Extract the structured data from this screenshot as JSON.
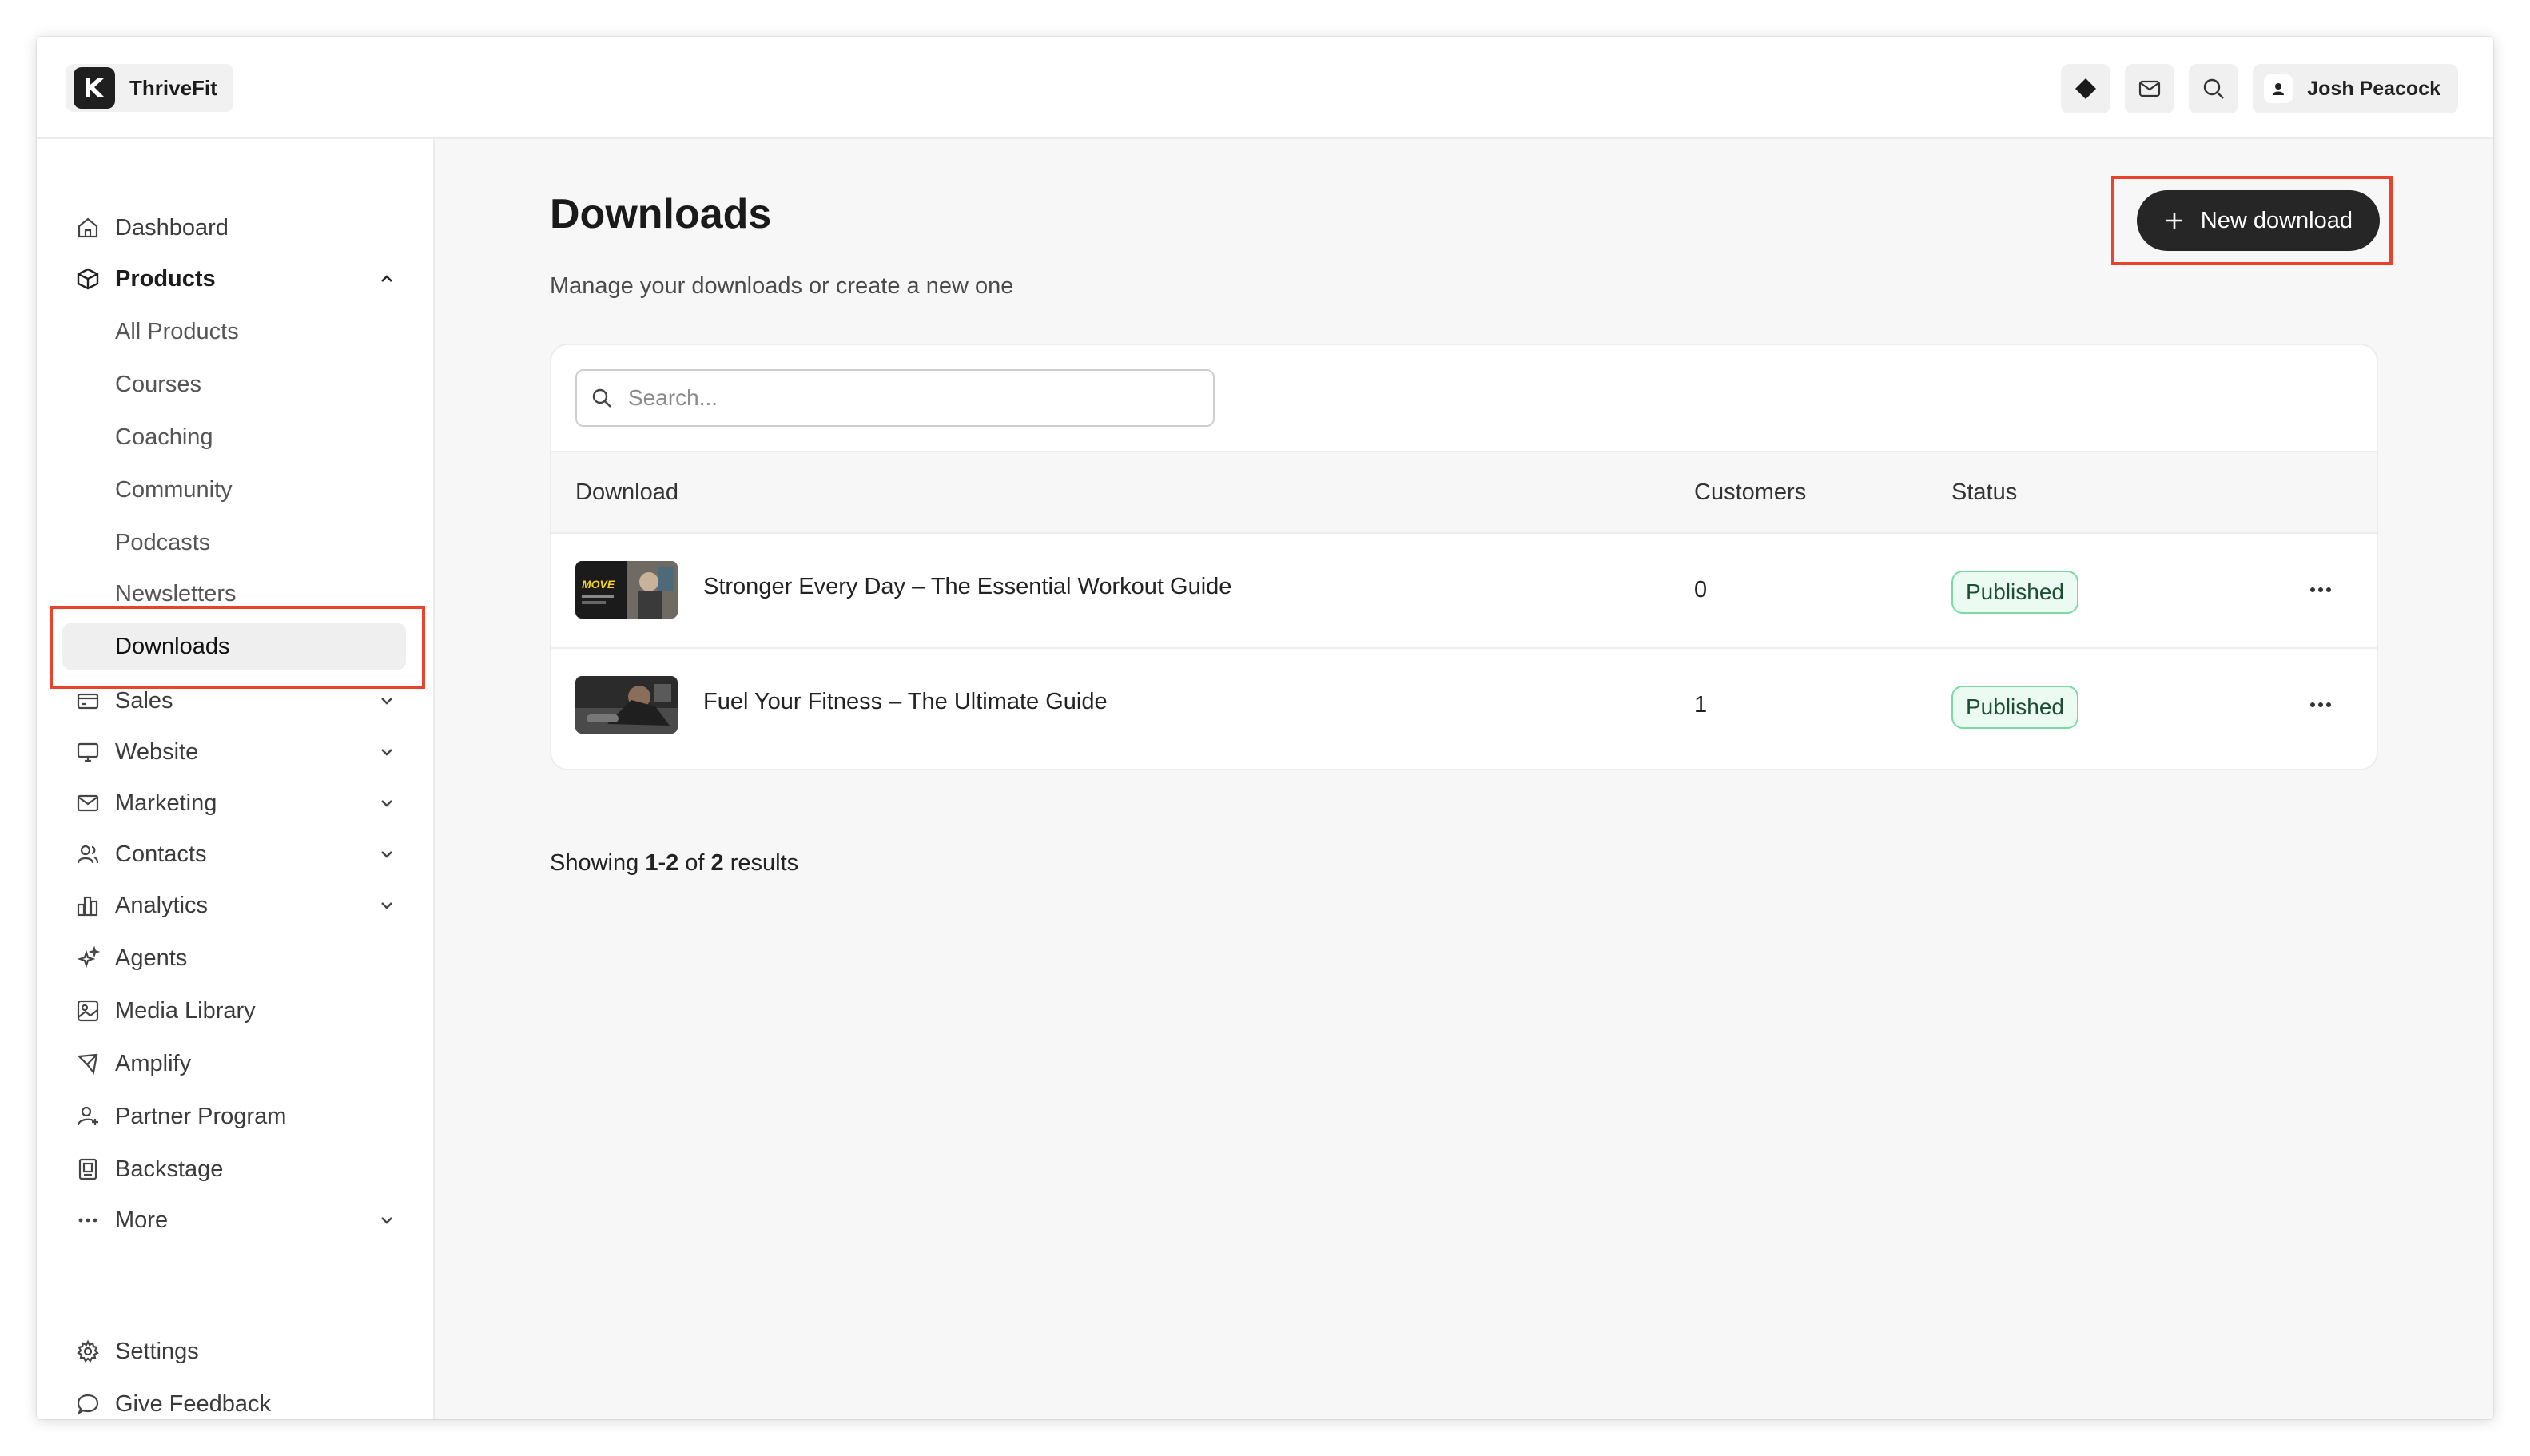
{
  "app": {
    "name": "ThriveFit"
  },
  "topbar": {
    "user_name": "Josh Peacock",
    "icons": [
      "diamond-icon",
      "mail-icon",
      "search-icon",
      "user-icon"
    ]
  },
  "sidebar": {
    "items": [
      {
        "label": "Dashboard",
        "icon": "home-icon"
      },
      {
        "label": "Products",
        "icon": "box-icon",
        "expanded": true
      },
      {
        "label": "Sales",
        "icon": "card-icon"
      },
      {
        "label": "Website",
        "icon": "monitor-icon"
      },
      {
        "label": "Marketing",
        "icon": "mail-icon"
      },
      {
        "label": "Contacts",
        "icon": "users-icon"
      },
      {
        "label": "Analytics",
        "icon": "bar-chart-icon"
      },
      {
        "label": "Agents",
        "icon": "sparkle-icon"
      },
      {
        "label": "Media Library",
        "icon": "image-icon"
      },
      {
        "label": "Amplify",
        "icon": "megaphone-icon"
      },
      {
        "label": "Partner Program",
        "icon": "partner-icon"
      },
      {
        "label": "Backstage",
        "icon": "backstage-icon"
      },
      {
        "label": "More",
        "icon": "dots-icon"
      }
    ],
    "products_sub": [
      "All Products",
      "Courses",
      "Coaching",
      "Community",
      "Podcasts",
      "Newsletters",
      "Downloads"
    ],
    "active_sub": "Downloads",
    "footer": [
      {
        "label": "Settings",
        "icon": "gear-icon"
      },
      {
        "label": "Give Feedback",
        "icon": "chat-icon"
      }
    ]
  },
  "main": {
    "title": "Downloads",
    "subtitle": "Manage your downloads or create a new one",
    "new_button_label": "New download",
    "search_placeholder": "Search...",
    "table": {
      "columns": [
        "Download",
        "Customers",
        "Status"
      ],
      "rows": [
        {
          "name": "Stronger Every Day – The Essential Workout Guide",
          "customers": "0",
          "status": "Published",
          "thumb_text": "MOVE"
        },
        {
          "name": "Fuel Your Fitness – The Ultimate Guide",
          "customers": "1",
          "status": "Published"
        }
      ]
    },
    "results": {
      "prefix": "Showing",
      "range": "1-2",
      "of": "of",
      "total": "2",
      "suffix": "results"
    }
  },
  "colors": {
    "highlight": "#e8432c",
    "badge_border": "#7ad9a4",
    "button": "#262626"
  }
}
